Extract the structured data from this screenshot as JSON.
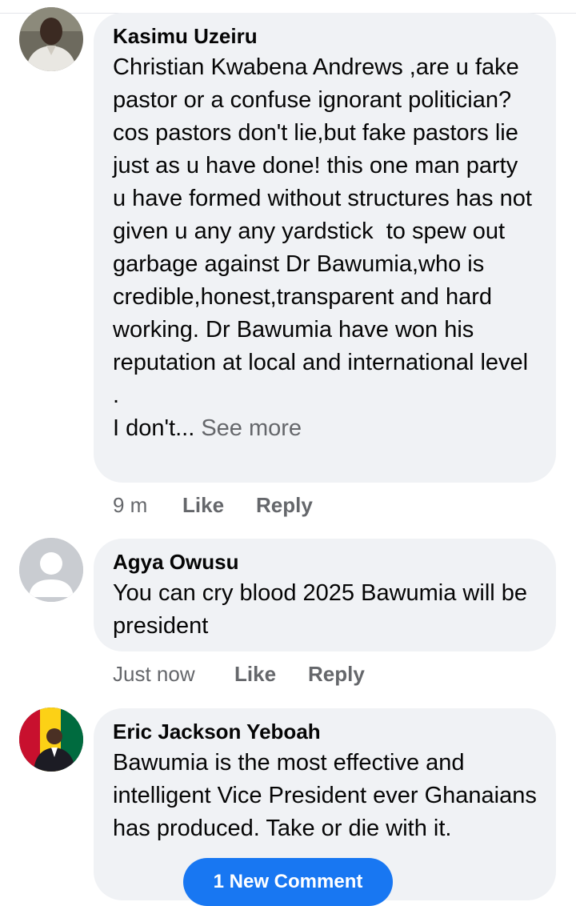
{
  "comments": [
    {
      "author": "Kasimu Uzeiru",
      "text": "Christian Kwabena Andrews ,are u fake pastor or a confuse ignorant politician? cos pastors don't lie,but fake pastors lie just as u have done! this one man party u have formed without structures has not given u any any yardstick  to spew out garbage against Dr Bawumia,who is credible,honest,transparent and hard working. Dr Bawumia have won his reputation at local and international level .\nI don't...",
      "see_more": "See more",
      "time": "9 m",
      "like": "Like",
      "reply": "Reply",
      "avatar_icon": "user-photo-man-white-shirt"
    },
    {
      "author": "Agya Owusu",
      "text": "You can cry blood 2025 Bawumia will be president",
      "time": "Just now",
      "like": "Like",
      "reply": "Reply",
      "avatar_icon": "default-user-silhouette"
    },
    {
      "author": "Eric Jackson Yeboah",
      "text": "Bawumia is the most effective and intelligent Vice President ever Ghanaians has produced. Take or die with it.",
      "avatar_icon": "user-photo-man-with-flag"
    }
  ],
  "new_comment_label": "1 New Comment",
  "colors": {
    "bubble": "#f0f2f5",
    "secondary_text": "#65676b",
    "primary_text": "#050505",
    "accent": "#1877f2"
  }
}
